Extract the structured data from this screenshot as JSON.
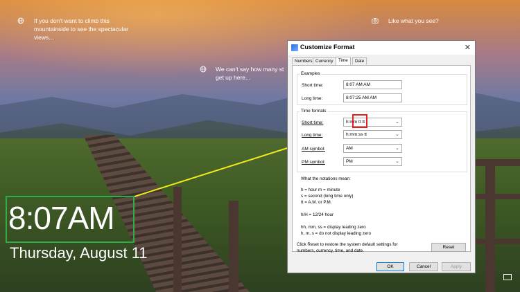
{
  "lock_screen": {
    "tips": [
      {
        "icon": "globe-icon",
        "text_line1": "If you don't want to climb this",
        "text_line2": "mountainside to see the spectacular",
        "text_line3": "views..."
      },
      {
        "icon": "globe-icon",
        "text_line1": "We can't say how many st",
        "text_line2": "get up here..."
      },
      {
        "icon": "camera-icon",
        "text_line1": "Like what you see?"
      }
    ],
    "clock": {
      "time": "8:07AM",
      "date": "Thursday, August 11"
    },
    "highlight_color": "#2fae48"
  },
  "dialog": {
    "title": "Customize Format",
    "close_glyph": "✕",
    "tabs": [
      "Numbers",
      "Currency",
      "Time",
      "Date"
    ],
    "active_tab": "Time",
    "examples": {
      "label": "Examples",
      "short_time_label": "Short time:",
      "short_time_value": "8:07 AM AM",
      "long_time_label": "Long time:",
      "long_time_value": "8:07:25 AM AM"
    },
    "time_formats": {
      "label": "Time formats",
      "short_time_label": "Short time:",
      "short_time_value": "h:mm tt tt",
      "long_time_label": "Long time:",
      "long_time_value": "h:mm:ss tt",
      "am_label": "AM symbol:",
      "am_value": "AM",
      "pm_label": "PM symbol:",
      "pm_value": "PM"
    },
    "notations": {
      "heading": "What the notations mean:",
      "lines": [
        "h = hour   m = minute",
        "s = second (long time only)",
        "tt = A.M. or P.M.",
        "h/H = 12/24 hour",
        "hh, mm, ss = display leading zero",
        "h, m, s = do not display leading zero"
      ]
    },
    "reset_text_line1": "Click Reset to restore the system default settings for",
    "reset_text_line2": "numbers, currency, time, and date.",
    "buttons": {
      "reset": "Reset",
      "ok": "OK",
      "cancel": "Cancel",
      "apply": "Apply"
    }
  },
  "annotation": {
    "box_color": "#e0231c",
    "line_color": "#f2ea1d"
  }
}
